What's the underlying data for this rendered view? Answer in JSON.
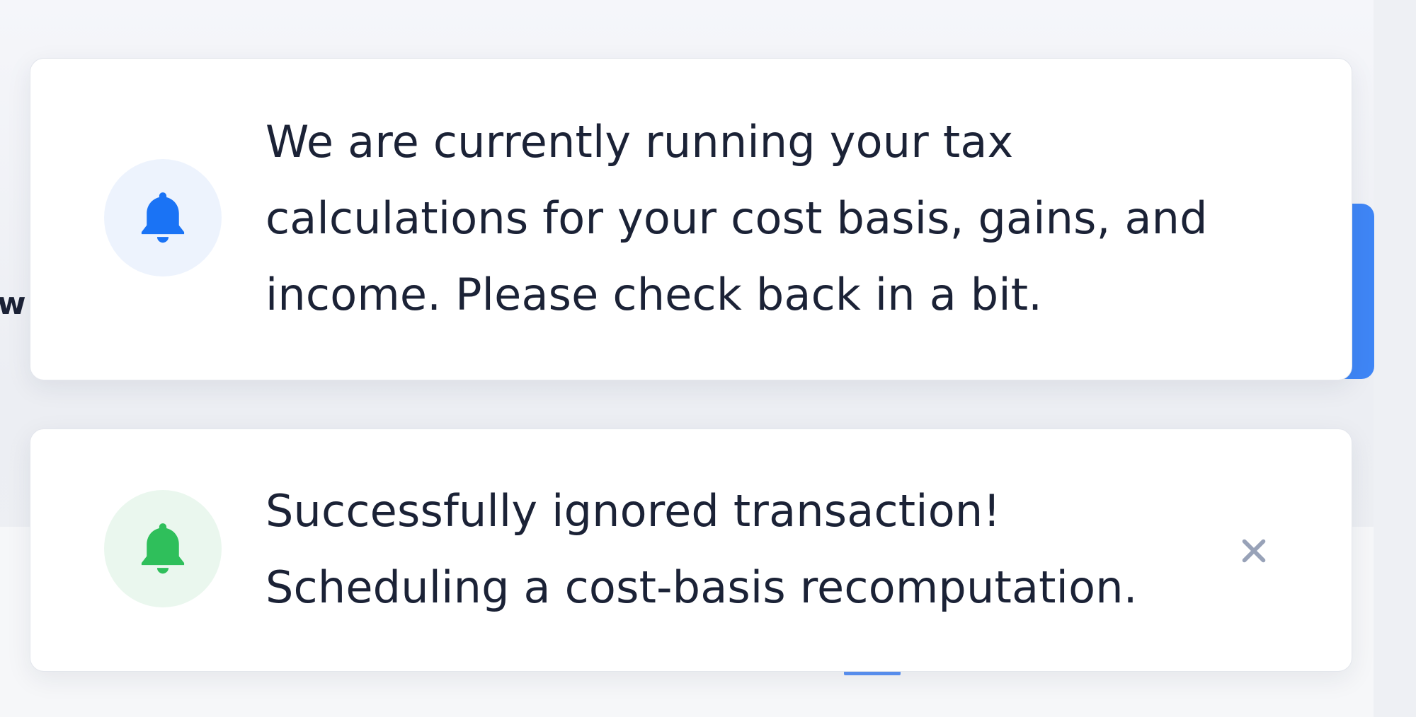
{
  "background": {
    "peek_char": "w"
  },
  "notifications": [
    {
      "icon": "bell-icon",
      "icon_color": "#1a73f5",
      "icon_bg": "#edf3fd",
      "lines": [
        "We are currently running your tax",
        "calculations for your cost basis, gains, and",
        "income. Please check back in a bit."
      ],
      "dismissible": false
    },
    {
      "icon": "bell-icon",
      "icon_color": "#2fbf5b",
      "icon_bg": "#eaf7ee",
      "lines": [
        "Successfully ignored transaction!",
        "Scheduling a cost-basis recomputation."
      ],
      "dismissible": true,
      "close_icon": "close-icon"
    }
  ],
  "colors": {
    "text": "#1b2236",
    "accent_blue": "#3f86f6",
    "close_icon": "#98a2b8"
  }
}
